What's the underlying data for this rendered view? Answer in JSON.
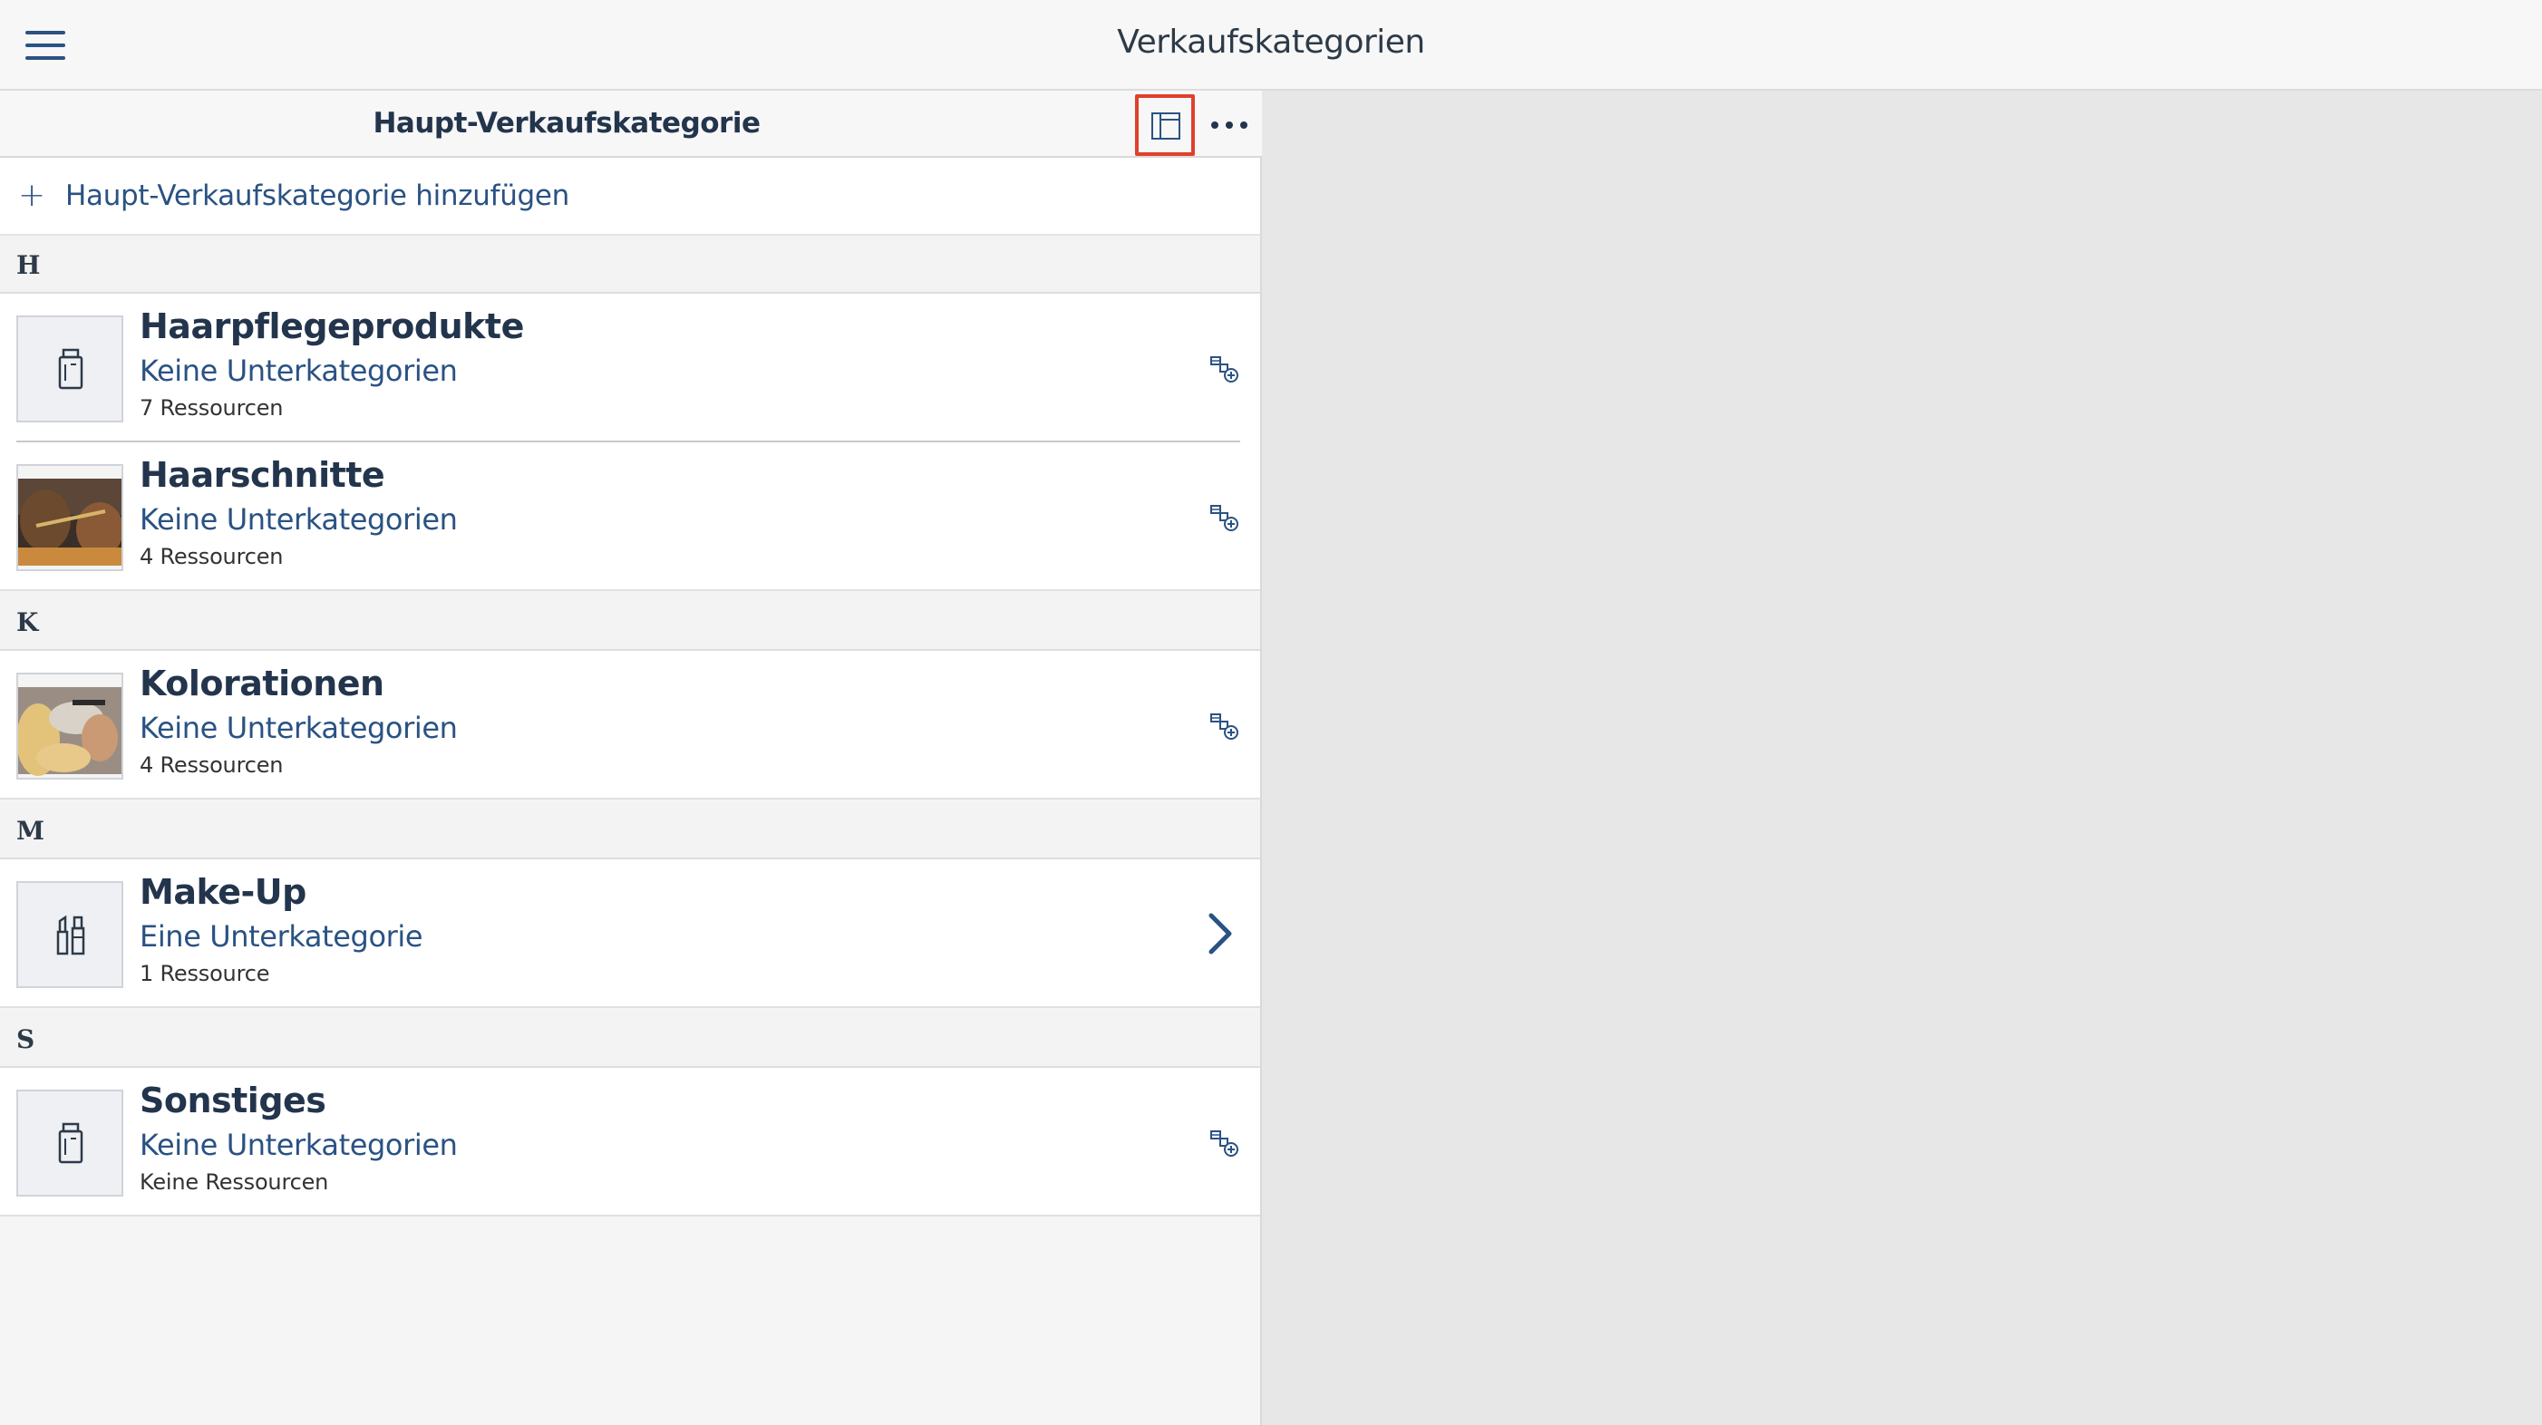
{
  "app": {
    "title": "Verkaufskategorien"
  },
  "panel": {
    "title": "Haupt-Verkaufskategorie",
    "add_label": "Haupt-Verkaufskategorie hinzufügen"
  },
  "sections": [
    {
      "letter": "H",
      "items": [
        {
          "title": "Haarpflegeprodukte",
          "subtitle": "Keine Unterkategorien",
          "meta": "7 Ressourcen",
          "thumb": "product-icon",
          "action": "add-subcategory-icon"
        },
        {
          "title": "Haarschnitte",
          "subtitle": "Keine Unterkategorien",
          "meta": "4 Ressourcen",
          "thumb": "haircut-photo",
          "action": "add-subcategory-icon"
        }
      ]
    },
    {
      "letter": "K",
      "items": [
        {
          "title": "Kolorationen",
          "subtitle": "Keine Unterkategorien",
          "meta": "4 Ressourcen",
          "thumb": "coloring-photo",
          "action": "add-subcategory-icon"
        }
      ]
    },
    {
      "letter": "M",
      "items": [
        {
          "title": "Make-Up",
          "subtitle": "Eine Unterkategorie",
          "meta": "1 Ressource",
          "thumb": "makeup-icon",
          "action": "chevron-right-icon"
        }
      ]
    },
    {
      "letter": "S",
      "items": [
        {
          "title": "Sonstiges",
          "subtitle": "Keine Unterkategorien",
          "meta": "Keine Ressourcen",
          "thumb": "product-icon",
          "action": "add-subcategory-icon"
        }
      ]
    }
  ],
  "colors": {
    "accent": "#2a5283",
    "title_text": "#23354d",
    "highlight_border": "#e0402c",
    "right_panel_bg": "#e7e7e7"
  }
}
